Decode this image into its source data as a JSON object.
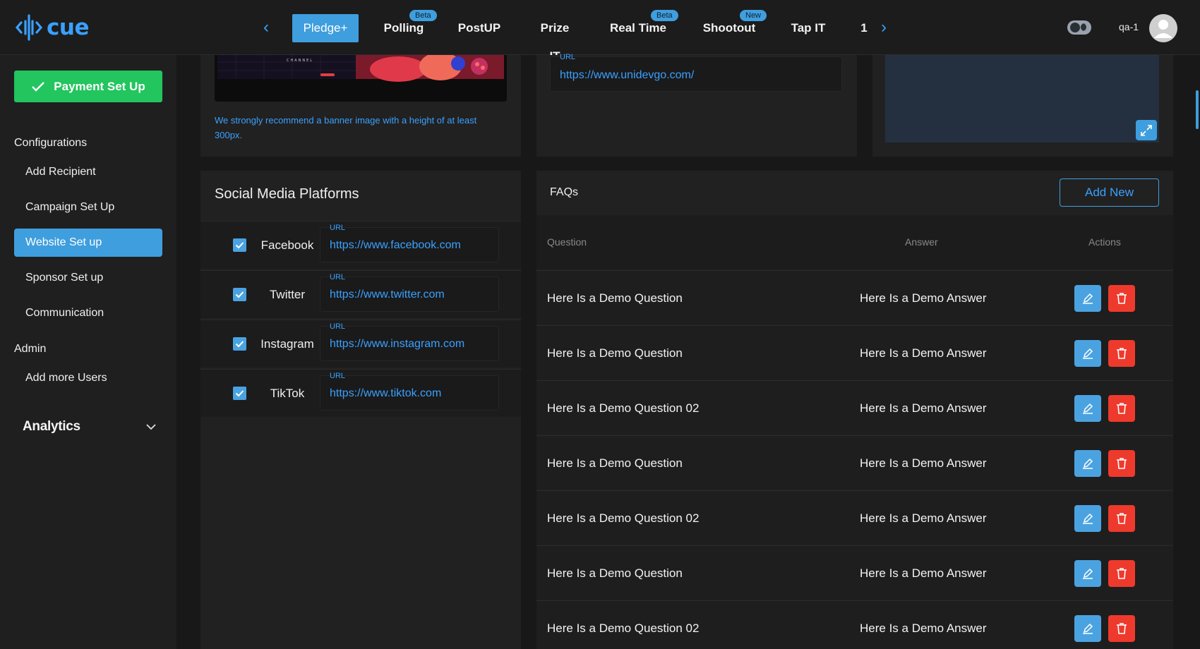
{
  "brand": {
    "name": "cue",
    "color": "#3aa0ff"
  },
  "nav": {
    "prev_icon": "chevron-left-icon",
    "next_icon": "chevron-right-icon",
    "tabs": [
      {
        "label": "Pledge+",
        "active": true,
        "badge": ""
      },
      {
        "label": "Polling",
        "active": false,
        "badge": "Beta"
      },
      {
        "label": "PostUP",
        "active": false,
        "badge": ""
      },
      {
        "label": "Prize IT",
        "active": false,
        "badge": ""
      },
      {
        "label": "Real Time",
        "active": false,
        "badge": "Beta"
      },
      {
        "label": "Shootout",
        "active": false,
        "badge": "New"
      },
      {
        "label": "Tap IT",
        "active": false,
        "badge": ""
      },
      {
        "label": "1",
        "active": false,
        "badge": ""
      }
    ]
  },
  "user": {
    "name": "qa-1",
    "avatar_icon": "user-avatar-icon"
  },
  "sidebar": {
    "payment_button": "Payment Set Up",
    "configurations_heading": "Configurations",
    "config_items": [
      {
        "label": "Add Recipient",
        "active": false
      },
      {
        "label": "Campaign Set Up",
        "active": false
      },
      {
        "label": "Website Set up",
        "active": true
      },
      {
        "label": "Sponsor Set up",
        "active": false
      },
      {
        "label": "Communication",
        "active": false
      }
    ],
    "admin_heading": "Admin",
    "admin_items": [
      {
        "label": "Add more Users"
      }
    ],
    "analytics_label": "Analytics"
  },
  "banner": {
    "note": "We strongly recommend a banner image with a height of at least 300px.",
    "image_caption": "CHANNEL"
  },
  "website": {
    "url_label": "URL",
    "url_value": "https://www.unidevgo.com/"
  },
  "social": {
    "title": "Social Media Platforms",
    "url_label": "URL",
    "platforms": [
      {
        "name": "Facebook",
        "url": "https://www.facebook.com",
        "checked": true
      },
      {
        "name": "Twitter",
        "url": "https://www.twitter.com",
        "checked": true
      },
      {
        "name": "Instagram",
        "url": "https://www.instagram.com",
        "checked": true
      },
      {
        "name": "TikTok",
        "url": "https://www.tiktok.com",
        "checked": true
      }
    ]
  },
  "faqs": {
    "title": "FAQs",
    "add_button": "Add New",
    "columns": {
      "question": "Question",
      "answer": "Answer",
      "actions": "Actions"
    },
    "rows": [
      {
        "question": "Here Is a Demo Question",
        "answer": "Here Is a Demo Answer"
      },
      {
        "question": "Here Is a Demo Question",
        "answer": "Here Is a Demo Answer"
      },
      {
        "question": "Here Is a Demo Question 02",
        "answer": "Here Is a Demo Answer"
      },
      {
        "question": "Here Is a Demo Question",
        "answer": "Here Is a Demo Answer"
      },
      {
        "question": "Here Is a Demo Question 02",
        "answer": "Here Is a Demo Answer"
      },
      {
        "question": "Here Is a Demo Question",
        "answer": "Here Is a Demo Answer"
      },
      {
        "question": "Here Is a Demo Question 02",
        "answer": "Here Is a Demo Answer"
      }
    ]
  },
  "colors": {
    "accent": "#3f9ede",
    "success": "#22c55e",
    "danger": "#ee3a2c",
    "background": "#181818"
  }
}
